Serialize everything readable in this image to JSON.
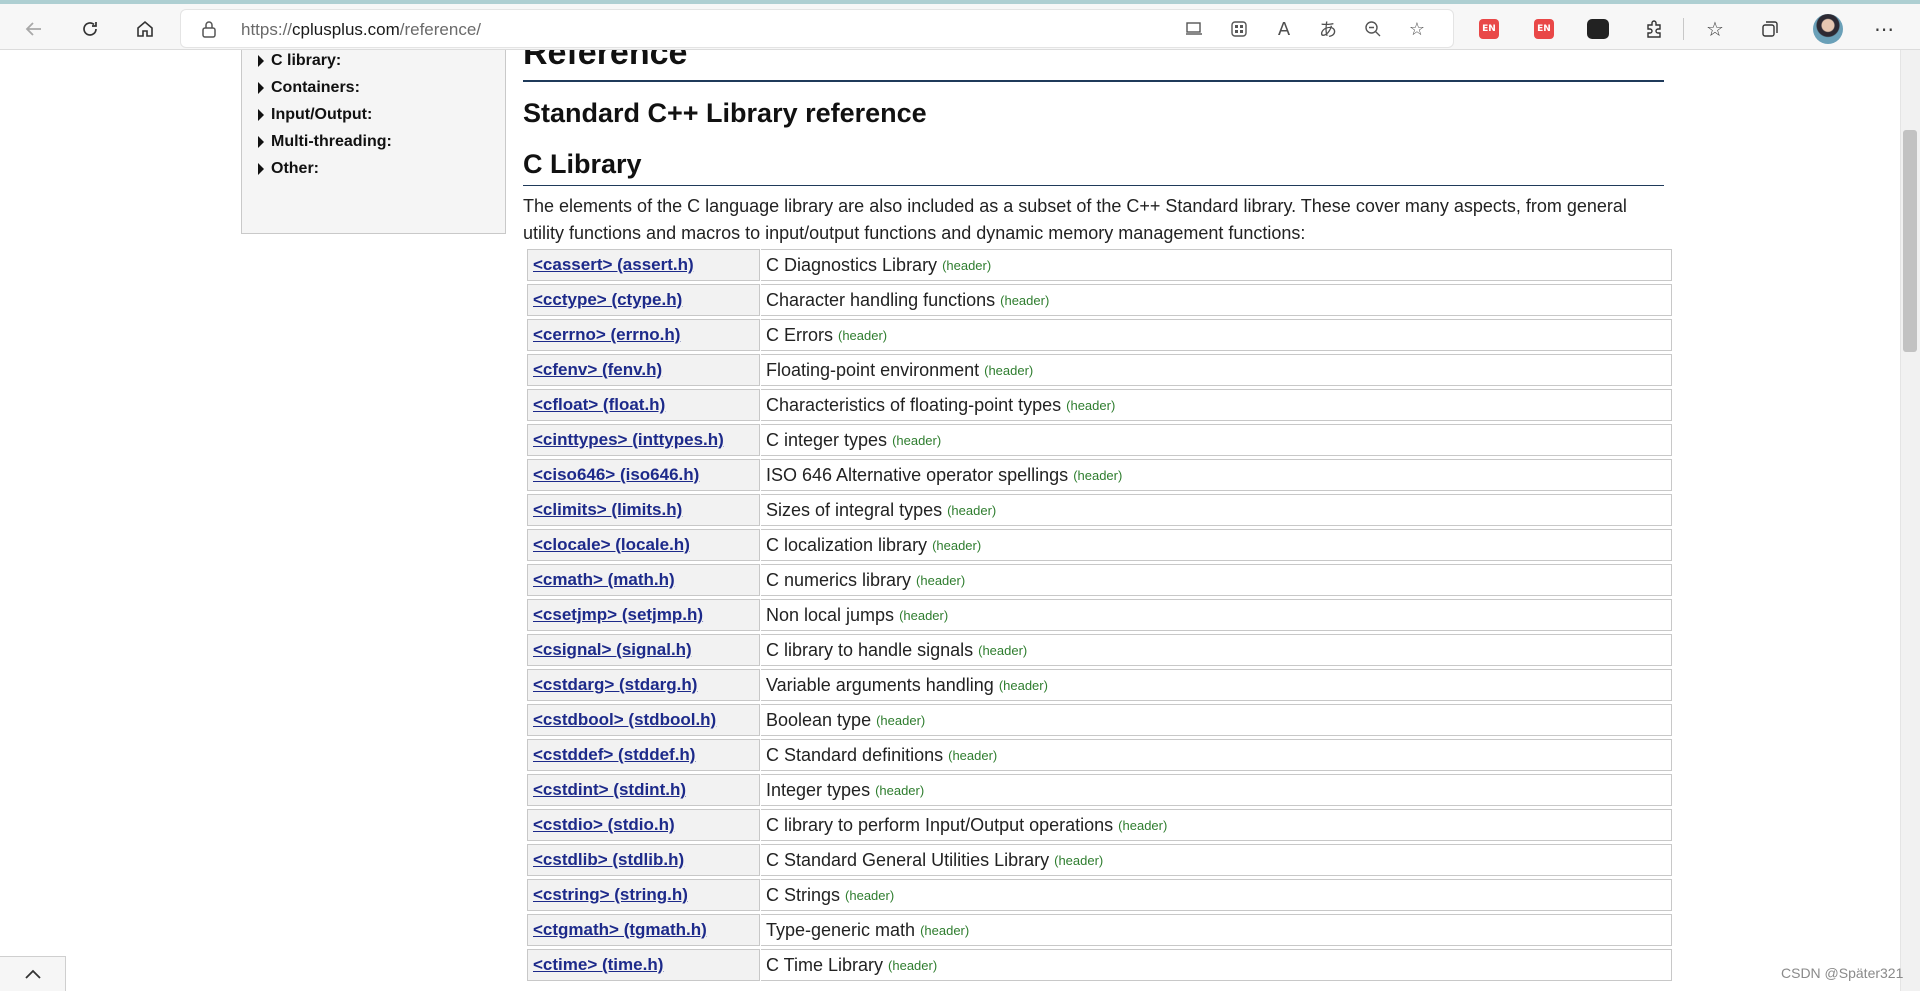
{
  "browser": {
    "url_prefix": "https://",
    "url_domain": "cplusplus.com",
    "url_path": "/reference/",
    "extension_label": "EN"
  },
  "sidebar": {
    "items": [
      {
        "label": "C library:"
      },
      {
        "label": "Containers:"
      },
      {
        "label": "Input/Output:"
      },
      {
        "label": "Multi-threading:"
      },
      {
        "label": "Other:"
      }
    ]
  },
  "content": {
    "heading_reference": "Reference",
    "heading_std": "Standard C++ Library reference",
    "heading_clib": "C Library",
    "intro": "The elements of the C language library are also included as a subset of the C++ Standard library. These cover many aspects, from general utility functions and macros to input/output functions and dynamic memory management functions:",
    "rows": [
      {
        "name": "<cassert> (assert.h)",
        "desc": "C Diagnostics Library",
        "tag": "(header)"
      },
      {
        "name": "<cctype> (ctype.h)",
        "desc": "Character handling functions",
        "tag": "(header)"
      },
      {
        "name": "<cerrno> (errno.h)",
        "desc": "C Errors",
        "tag": "(header)"
      },
      {
        "name": "<cfenv> (fenv.h)",
        "desc": "Floating-point environment",
        "tag": "(header)"
      },
      {
        "name": "<cfloat> (float.h)",
        "desc": "Characteristics of floating-point types",
        "tag": "(header)"
      },
      {
        "name": "<cinttypes> (inttypes.h)",
        "desc": "C integer types",
        "tag": "(header)"
      },
      {
        "name": "<ciso646> (iso646.h)",
        "desc": "ISO 646 Alternative operator spellings",
        "tag": "(header)"
      },
      {
        "name": "<climits> (limits.h)",
        "desc": "Sizes of integral types",
        "tag": "(header)"
      },
      {
        "name": "<clocale> (locale.h)",
        "desc": "C localization library",
        "tag": "(header)"
      },
      {
        "name": "<cmath> (math.h)",
        "desc": "C numerics library",
        "tag": "(header)"
      },
      {
        "name": "<csetjmp> (setjmp.h)",
        "desc": "Non local jumps",
        "tag": "(header)"
      },
      {
        "name": "<csignal> (signal.h)",
        "desc": "C library to handle signals",
        "tag": "(header)"
      },
      {
        "name": "<cstdarg> (stdarg.h)",
        "desc": "Variable arguments handling",
        "tag": "(header)"
      },
      {
        "name": "<cstdbool> (stdbool.h)",
        "desc": "Boolean type",
        "tag": "(header)"
      },
      {
        "name": "<cstddef> (stddef.h)",
        "desc": "C Standard definitions",
        "tag": "(header)"
      },
      {
        "name": "<cstdint> (stdint.h)",
        "desc": "Integer types",
        "tag": "(header)"
      },
      {
        "name": "<cstdio> (stdio.h)",
        "desc": "C library to perform Input/Output operations",
        "tag": "(header)"
      },
      {
        "name": "<cstdlib> (stdlib.h)",
        "desc": "C Standard General Utilities Library",
        "tag": "(header)"
      },
      {
        "name": "<cstring> (string.h)",
        "desc": "C Strings",
        "tag": "(header)"
      },
      {
        "name": "<ctgmath> (tgmath.h)",
        "desc": "Type-generic math",
        "tag": "(header)"
      },
      {
        "name": "<ctime> (time.h)",
        "desc": "C Time Library",
        "tag": "(header)"
      }
    ]
  },
  "watermark": "CSDN @Später321",
  "colors": {
    "link": "#1d2a8a",
    "header_tag": "#2e7d2e",
    "heading_rule": "#1f3a5a"
  }
}
